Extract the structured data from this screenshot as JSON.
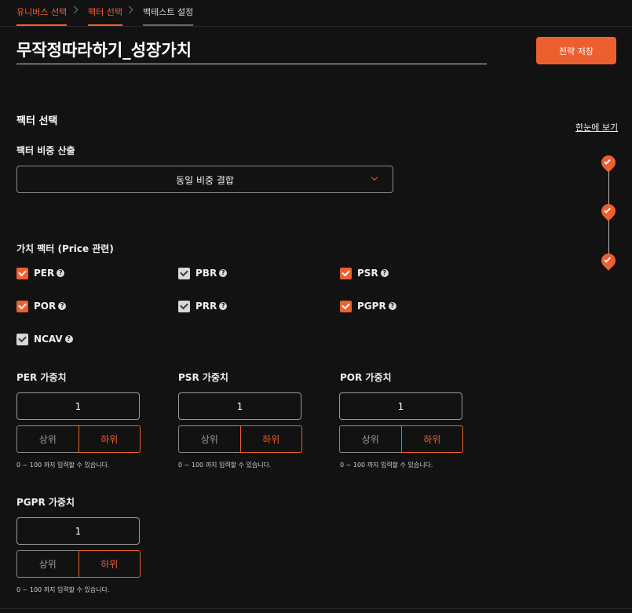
{
  "breadcrumb": {
    "items": [
      {
        "label": "유니버스 선택",
        "state": "done"
      },
      {
        "label": "팩터 선택",
        "state": "done"
      },
      {
        "label": "백테스트 설정",
        "state": "current"
      }
    ]
  },
  "header": {
    "title": "무작정따라하기_성장가치",
    "save_label": "전략 저장"
  },
  "factor_section": {
    "title": "팩터 선택",
    "overview_link": "한눈에 보기",
    "weight_calc_label": "팩터 비중 산출",
    "weight_calc_value": "동일 비중 결합"
  },
  "value_factors": {
    "title": "가치 팩터 (Price 관련)",
    "help_glyph": "?",
    "items": [
      {
        "label": "PER",
        "checked": true
      },
      {
        "label": "PBR",
        "checked": false
      },
      {
        "label": "PSR",
        "checked": true
      },
      {
        "label": "POR",
        "checked": true
      },
      {
        "label": "PRR",
        "checked": false
      },
      {
        "label": "PGPR",
        "checked": true
      },
      {
        "label": "NCAV",
        "checked": false
      }
    ]
  },
  "weights": [
    {
      "label": "PER 가중치",
      "value": "1",
      "upper": "상위",
      "lower": "하위",
      "selected": "하위",
      "hint": "0 ~ 100 까지 입력할 수 있습니다."
    },
    {
      "label": "PSR 가중치",
      "value": "1",
      "upper": "상위",
      "lower": "하위",
      "selected": "하위",
      "hint": "0 ~ 100 까지 입력할 수 있습니다."
    },
    {
      "label": "POR 가중치",
      "value": "1",
      "upper": "상위",
      "lower": "하위",
      "selected": "하위",
      "hint": "0 ~ 100 까지 입력할 수 있습니다."
    },
    {
      "label": "PGPR 가중치",
      "value": "1",
      "upper": "상위",
      "lower": "하위",
      "selected": "하위",
      "hint": "0 ~ 100 까지 입력할 수 있습니다."
    }
  ],
  "stepper": {
    "completed_steps": 3
  },
  "colors": {
    "accent": "#ee5f2f",
    "background": "#121212"
  }
}
